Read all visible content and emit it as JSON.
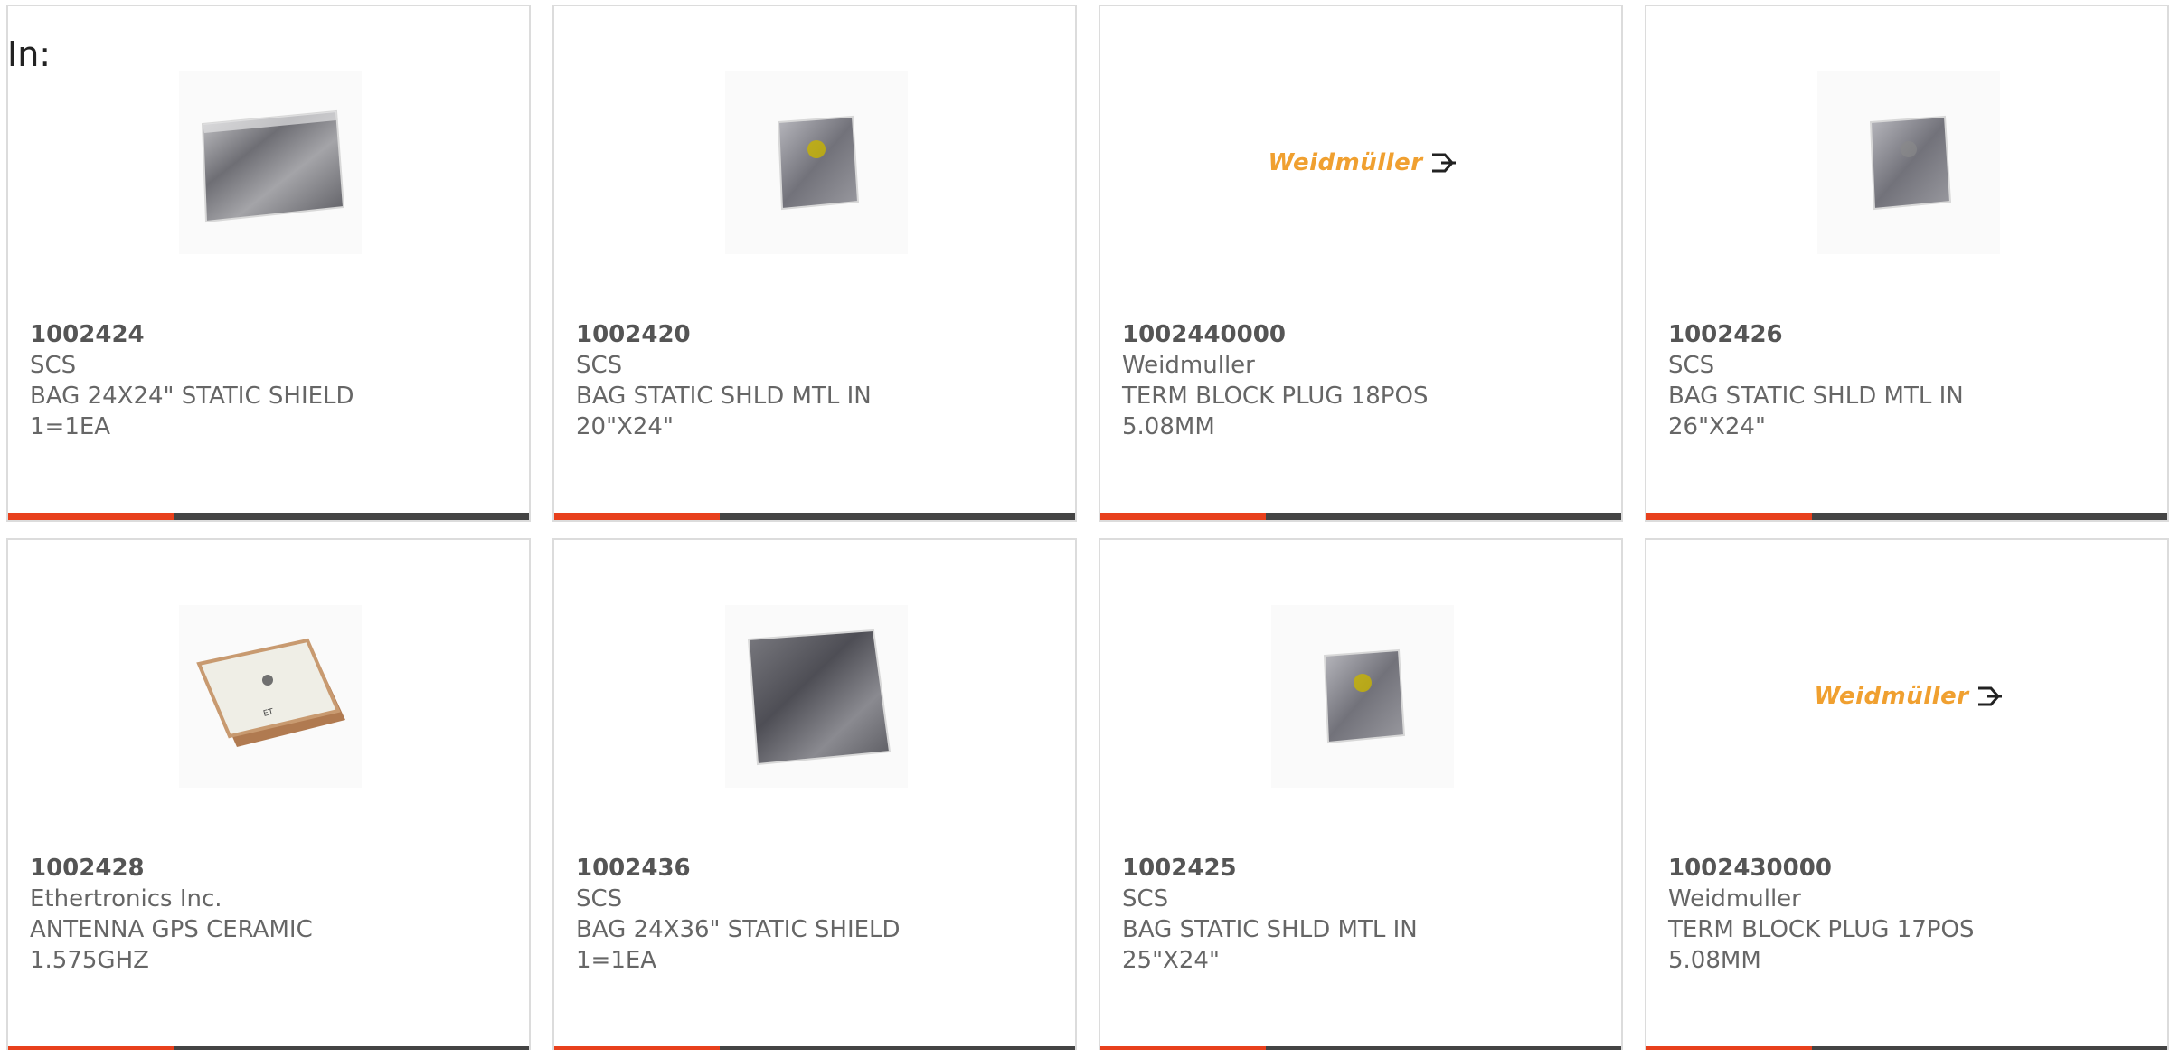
{
  "header": {
    "in_label": "In:"
  },
  "colors": {
    "accent": "#e8401c",
    "bar": "#444444",
    "border": "#dcdcdc",
    "logo": "#f0a030"
  },
  "products": [
    {
      "part_number": "1002424",
      "manufacturer": "SCS",
      "desc1": "BAG 24X24\" STATIC SHIELD",
      "desc2": "1=1EA",
      "image": "static-bag-large-icon"
    },
    {
      "part_number": "1002420",
      "manufacturer": "SCS",
      "desc1": "BAG STATIC SHLD MTL IN",
      "desc2": "20\"X24\"",
      "image": "static-bag-small-icon"
    },
    {
      "part_number": "1002440000",
      "manufacturer": "Weidmuller",
      "desc1": "TERM BLOCK PLUG 18POS",
      "desc2": "5.08MM",
      "image": "weidmuller-logo",
      "logo_text": "Weidmüller"
    },
    {
      "part_number": "1002426",
      "manufacturer": "SCS",
      "desc1": "BAG STATIC SHLD MTL IN",
      "desc2": "26\"X24\"",
      "image": "static-bag-small-icon"
    },
    {
      "part_number": "1002428",
      "manufacturer": "Ethertronics Inc.",
      "desc1": "ANTENNA GPS CERAMIC",
      "desc2": "1.575GHZ",
      "image": "ceramic-antenna-icon"
    },
    {
      "part_number": "1002436",
      "manufacturer": "SCS",
      "desc1": "BAG 24X36\" STATIC SHIELD",
      "desc2": "1=1EA",
      "image": "static-bag-large-icon"
    },
    {
      "part_number": "1002425",
      "manufacturer": "SCS",
      "desc1": "BAG STATIC SHLD MTL IN",
      "desc2": "25\"X24\"",
      "image": "static-bag-small-icon"
    },
    {
      "part_number": "1002430000",
      "manufacturer": "Weidmuller",
      "desc1": "TERM BLOCK PLUG 17POS",
      "desc2": "5.08MM",
      "image": "weidmuller-logo",
      "logo_text": "Weidmüller"
    }
  ]
}
